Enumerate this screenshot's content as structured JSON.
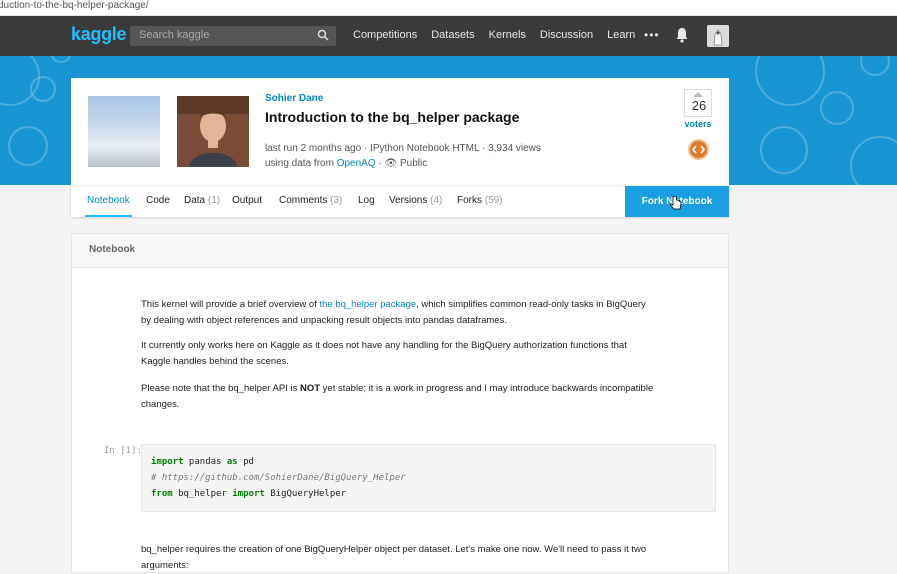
{
  "browser": {
    "url": "duction-to-the-bq-helper-package/"
  },
  "topnav": {
    "logo": "kaggle",
    "search_placeholder": "Search kaggle",
    "links": [
      "Competitions",
      "Datasets",
      "Kernels",
      "Discussion",
      "Learn"
    ],
    "more": "•••"
  },
  "kernel": {
    "author": "Sohier Dane",
    "title": "Introduction to the bq_helper package",
    "meta_line1": "last run 2 months ago · IPython Notebook HTML · 3,934 views",
    "meta_line2_prefix": "using data from ",
    "meta_line2_link": "OpenAQ",
    "meta_line2_suffix": " · 👁 Public",
    "votes": "26",
    "voters_label": "voters"
  },
  "tabs": [
    {
      "label": "Notebook",
      "count": ""
    },
    {
      "label": "Code",
      "count": ""
    },
    {
      "label": "Data",
      "count": "(1)"
    },
    {
      "label": "Output",
      "count": ""
    },
    {
      "label": "Comments",
      "count": "(3)"
    },
    {
      "label": "Log",
      "count": ""
    },
    {
      "label": "Versions",
      "count": "(4)"
    },
    {
      "label": "Forks",
      "count": "(59)"
    }
  ],
  "fork_button": "Fork Notebook",
  "notebook": {
    "header": "Notebook",
    "p1_a": "This kernel will provide a brief overview of ",
    "p1_link": "the bq_helper package",
    "p1_b": ", which simplifies common read-only tasks in BigQuery",
    "p1_c": "by dealing with object references and unpacking result objects into pandas dataframes.",
    "p2_a": "It currently only works here on Kaggle as it does not have any handling for the BigQuery authorization functions that",
    "p2_b": "Kaggle handles behind the scenes.",
    "p3_a": "Please note that the bq_helper API is ",
    "p3_bold": "NOT",
    "p3_b": " yet stable; it is a work in progress and I may introduce backwards incompatible",
    "p3_c": "changes.",
    "prompt": "In [1]:",
    "code1_kw1": "import",
    "code1_mid": " pandas ",
    "code1_kw2": "as",
    "code1_end": " pd",
    "code2": "# https://github.com/SohierDane/BigQuery_Helper",
    "code3_kw1": "from",
    "code3_mid": " bq_helper ",
    "code3_kw2": "import",
    "code3_end": " BigQueryHelper",
    "p4_a": "bq_helper requires the creation of one BigQueryHelper object per dataset. Let's make one now. We'll need to pass it two",
    "p4_b": "arguments:"
  },
  "colors": {
    "nav_bg": "#3b3b3b",
    "banner": "#1a95d3",
    "accent": "#20beff",
    "link": "#008abc",
    "fork_button": "#1a9fe0"
  },
  "icons": [
    "search-icon",
    "more-icon",
    "bell-icon",
    "user-avatar",
    "code-icon",
    "eye-icon",
    "cursor-icon"
  ]
}
